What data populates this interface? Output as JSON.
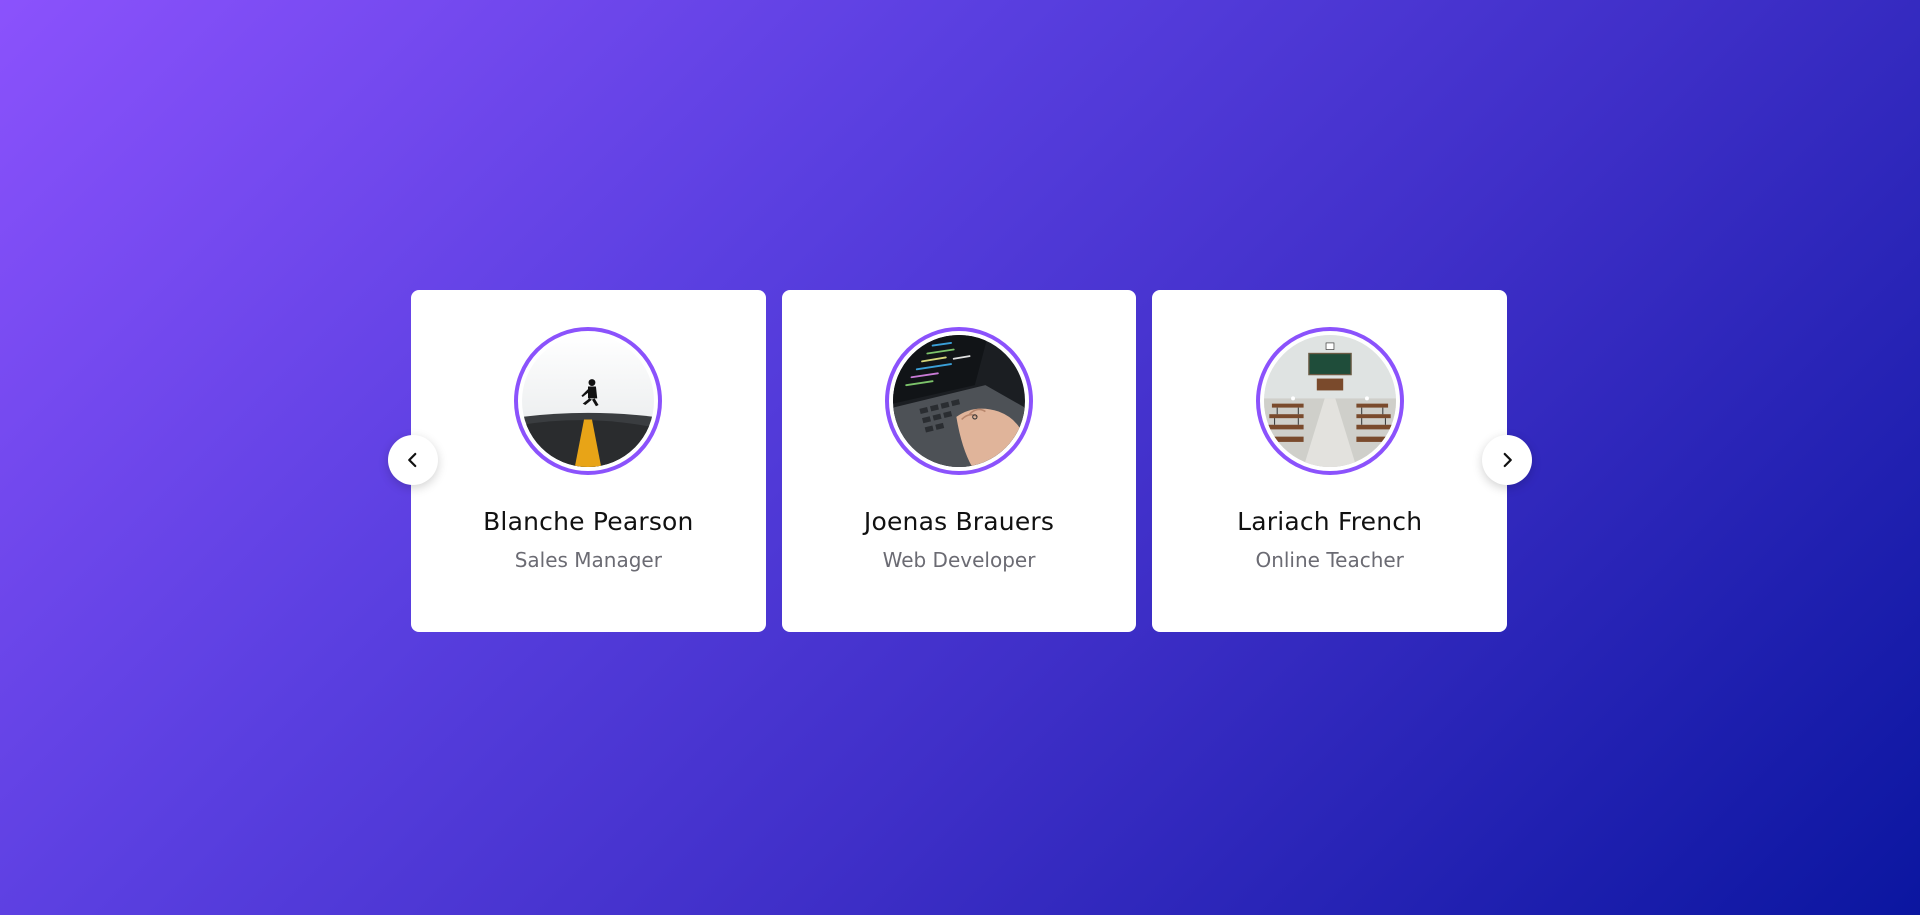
{
  "carousel": {
    "cards": [
      {
        "name": "Blanche Pearson",
        "role": "Sales Manager",
        "image": "person-jumping-on-road"
      },
      {
        "name": "Joenas Brauers",
        "role": "Web Developer",
        "image": "hands-typing-on-laptop"
      },
      {
        "name": "Lariach French",
        "role": "Online Teacher",
        "image": "empty-classroom"
      }
    ],
    "prev_icon": "chevron-left-icon",
    "next_icon": "chevron-right-icon"
  },
  "colors": {
    "accent": "#8b52fc",
    "background_start": "#8b52fc",
    "background_end": "#0b16a0",
    "card": "#ffffff",
    "name_text": "#111111",
    "role_text": "#6b6b73"
  }
}
